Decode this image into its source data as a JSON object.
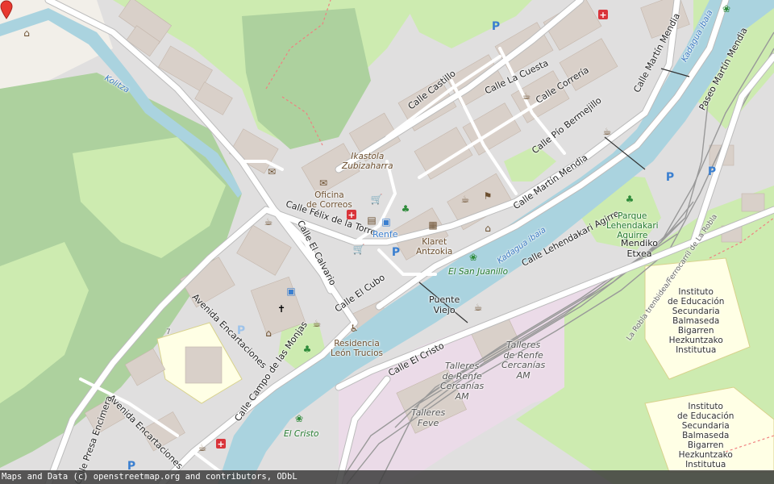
{
  "map": {
    "streets": [
      "Calle Castillo",
      "Calle La Cuesta",
      "Calle Correría",
      "Calle Martín Mendia",
      "Calle Pío Bermejillo",
      "Calle Martín Mendia",
      "Paseo Martín Mendia",
      "Calle Félix de la Torre",
      "Calle El Calvario",
      "Calle El Cubo",
      "Calle Lehendakari Agirre",
      "Avenida Encartaciones",
      "Calle Campo de las Monjas",
      "Calle El Cristo",
      "Avenida Encartaciones",
      "Calle Presa Encimera"
    ],
    "water": [
      "Kolitza",
      "Kadagua ibaia",
      "Kadagua ibaia",
      "La Robla trenbidea/Ferrocarril de La Robla"
    ],
    "places": {
      "ikastola": "Ikastola\nZubizaharra",
      "oficina": "Oficina\nde Correos",
      "renfe_short": "Renfe",
      "klaret": "Klaret\nAntzokia",
      "el_san_juanillo": "El San Juanillo",
      "puente_viejo": "Puente\nViejo",
      "residencia": "Residencia\nLeón Trucios",
      "parque": "Parque\nLehendakari\nAguirre",
      "mendiko": "Mendiko\nEtxea",
      "instituto1": "Instituto\nde Educación\nSecundaria\nBalmaseda\nBigarren\nHezkuntzako\nInstitutua",
      "instituto2": "Instituto\nde Educación\nSecundaria\nBalmaseda\nBigarren\nHezkuntzako\nInstitutua",
      "talleres1": "Talleres\nde Renfe\nCercanías\nAM",
      "talleres2": "Talleres\nde Renfe\nCercanías\nAM",
      "talleres_feve": "Talleres\nFeve",
      "el_cristo": "El Cristo",
      "house_number": "7"
    },
    "icons": [
      "shelter-icon",
      "parking-icon",
      "pharmacy-icon",
      "cafe-icon",
      "zoo-icon",
      "post-office-icon",
      "bus-stop-icon",
      "church-icon",
      "town-hall-icon",
      "theatre-icon"
    ],
    "colors": {
      "background": "#f2efe9",
      "residential": "#e0dfdf",
      "building": "#d9d0c9",
      "forest": "#add19e",
      "grass": "#cdebb0",
      "water": "#aad3df",
      "road": "#ffffff",
      "school": "#ffffe5",
      "railway_area": "#ebdbe8",
      "marker": "#e8382f"
    }
  },
  "attribution": "Maps and Data (c) openstreetmap.org and contributors, ODbL"
}
